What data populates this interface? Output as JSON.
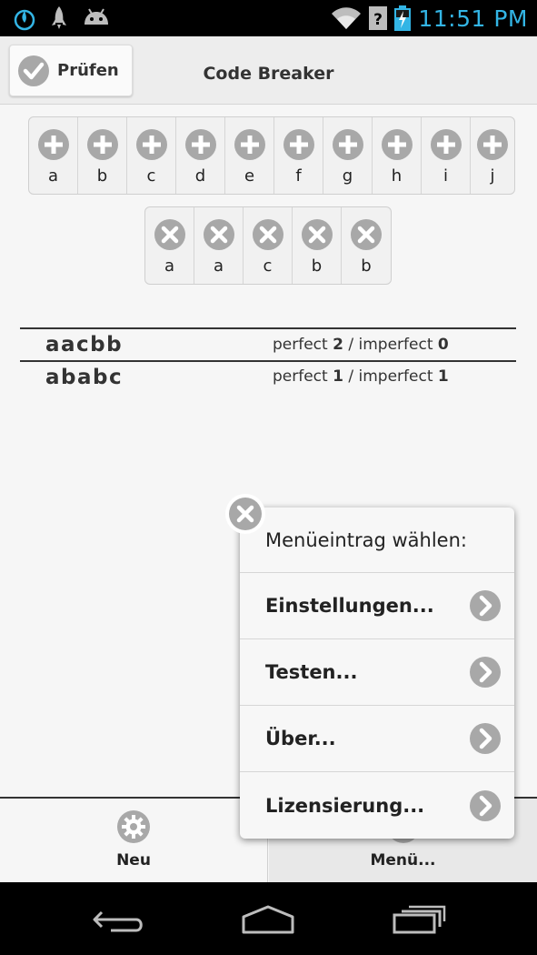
{
  "status_bar": {
    "time": "11:51 PM",
    "icons": [
      "flame-icon",
      "rocket-icon",
      "android-icon",
      "wifi-icon",
      "no-signal-icon",
      "battery-charging-icon"
    ],
    "time_color": "#33b5e5"
  },
  "header": {
    "check_button_label": "Prüfen",
    "title": "Code Breaker"
  },
  "available_pegs": [
    {
      "label": "a",
      "icon": "add-icon"
    },
    {
      "label": "b",
      "icon": "add-icon"
    },
    {
      "label": "c",
      "icon": "add-icon"
    },
    {
      "label": "d",
      "icon": "add-icon"
    },
    {
      "label": "e",
      "icon": "add-icon"
    },
    {
      "label": "f",
      "icon": "add-icon"
    },
    {
      "label": "g",
      "icon": "add-icon"
    },
    {
      "label": "h",
      "icon": "add-icon"
    },
    {
      "label": "i",
      "icon": "add-icon"
    },
    {
      "label": "j",
      "icon": "add-icon"
    }
  ],
  "current_guess": [
    {
      "label": "a",
      "icon": "remove-icon"
    },
    {
      "label": "a",
      "icon": "remove-icon"
    },
    {
      "label": "c",
      "icon": "remove-icon"
    },
    {
      "label": "b",
      "icon": "remove-icon"
    },
    {
      "label": "b",
      "icon": "remove-icon"
    }
  ],
  "guesses": [
    {
      "code": "aacbb",
      "perfect_label": "perfect",
      "perfect": "2",
      "separator": "/",
      "imperfect_label": "imperfect",
      "imperfect": "0"
    },
    {
      "code": "ababc",
      "perfect_label": "perfect",
      "perfect": "1",
      "separator": "/",
      "imperfect_label": "imperfect",
      "imperfect": "1"
    }
  ],
  "bottom_bar": {
    "new_label": "Neu",
    "menu_label": "Menü..."
  },
  "popup": {
    "title": "Menüeintrag wählen:",
    "items": [
      {
        "label": "Einstellungen..."
      },
      {
        "label": "Testen..."
      },
      {
        "label": "Über..."
      },
      {
        "label": "Lizensierung..."
      }
    ]
  }
}
